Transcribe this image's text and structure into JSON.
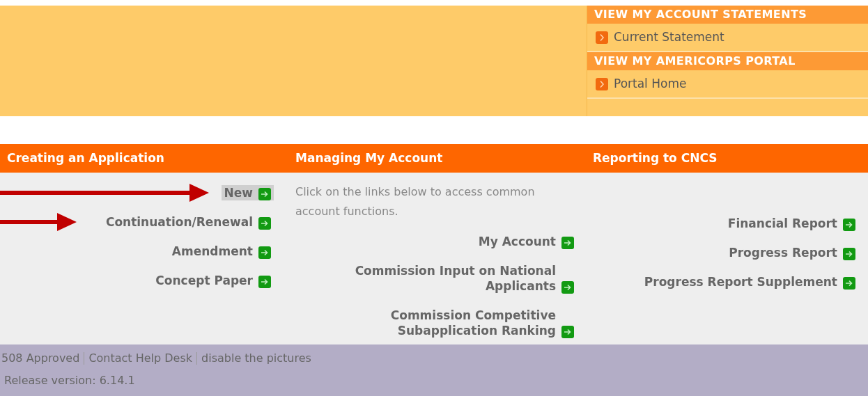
{
  "account_panel": {
    "sections": [
      {
        "heading": "VIEW MY ACCOUNT STATEMENTS",
        "links": [
          "Current Statement"
        ]
      },
      {
        "heading": "VIEW MY AMERICORPS PORTAL",
        "links": [
          "Portal Home"
        ]
      }
    ]
  },
  "columns": [
    {
      "heading": "Creating an Application",
      "links": [
        {
          "label": "New",
          "selected": true,
          "annotated": true
        },
        {
          "label": "Continuation/Renewal",
          "selected": false,
          "annotated": true
        },
        {
          "label": "Amendment",
          "selected": false,
          "annotated": false
        },
        {
          "label": "Concept Paper",
          "selected": false,
          "annotated": false
        }
      ]
    },
    {
      "heading": "Managing My Account",
      "description": "Click on the links below to access common account functions.",
      "links": [
        {
          "label": "My Account",
          "selected": false,
          "annotated": false
        },
        {
          "label": "Commission Input on National Applicants",
          "selected": false,
          "annotated": false
        },
        {
          "label": "Commission Competitive Subapplication Ranking",
          "selected": false,
          "annotated": false
        }
      ]
    },
    {
      "heading": "Reporting to CNCS",
      "links": [
        {
          "label": "Financial Report",
          "selected": false,
          "annotated": false
        },
        {
          "label": "Progress Report",
          "selected": false,
          "annotated": false
        },
        {
          "label": "Progress Report Supplement",
          "selected": false,
          "annotated": false
        }
      ]
    }
  ],
  "footer": {
    "links": [
      "508 Approved",
      "Contact Help Desk",
      "disable the pictures"
    ],
    "version": "Release version: 6.14.1"
  }
}
